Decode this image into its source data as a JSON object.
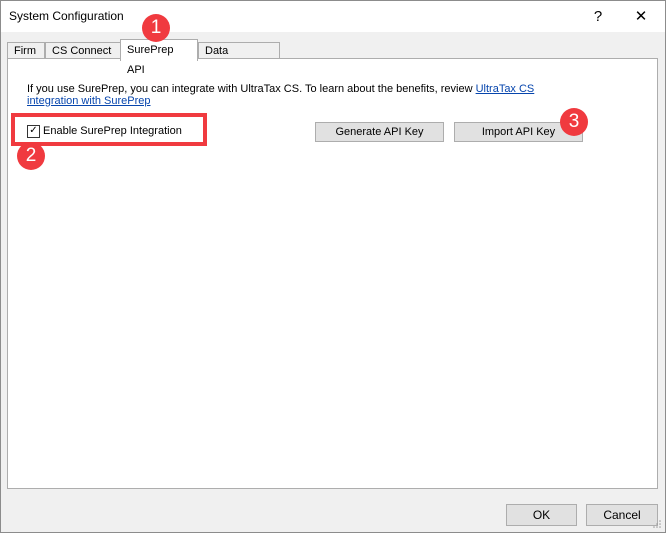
{
  "window": {
    "title": "System Configuration",
    "help_glyph": "?",
    "close_glyph": "✕"
  },
  "tabs": [
    {
      "label": "Firm"
    },
    {
      "label": "CS Connect"
    },
    {
      "label": "SurePrep API"
    },
    {
      "label": "Data Locations"
    }
  ],
  "panel": {
    "intro_text": "If you use SurePrep, you can integrate with UltraTax CS. To learn about the benefits, review ",
    "intro_link": "UltraTax CS integration with SurePrep",
    "enable_checkbox_label": "Enable SurePrep Integration",
    "enable_checked_glyph": "✓",
    "generate_button": "Generate API Key",
    "import_button": "Import API Key"
  },
  "callouts": [
    "1",
    "2",
    "3"
  ],
  "footer": {
    "ok": "OK",
    "cancel": "Cancel"
  },
  "colors": {
    "callout": "#f03a3f",
    "link": "#0645ad"
  }
}
